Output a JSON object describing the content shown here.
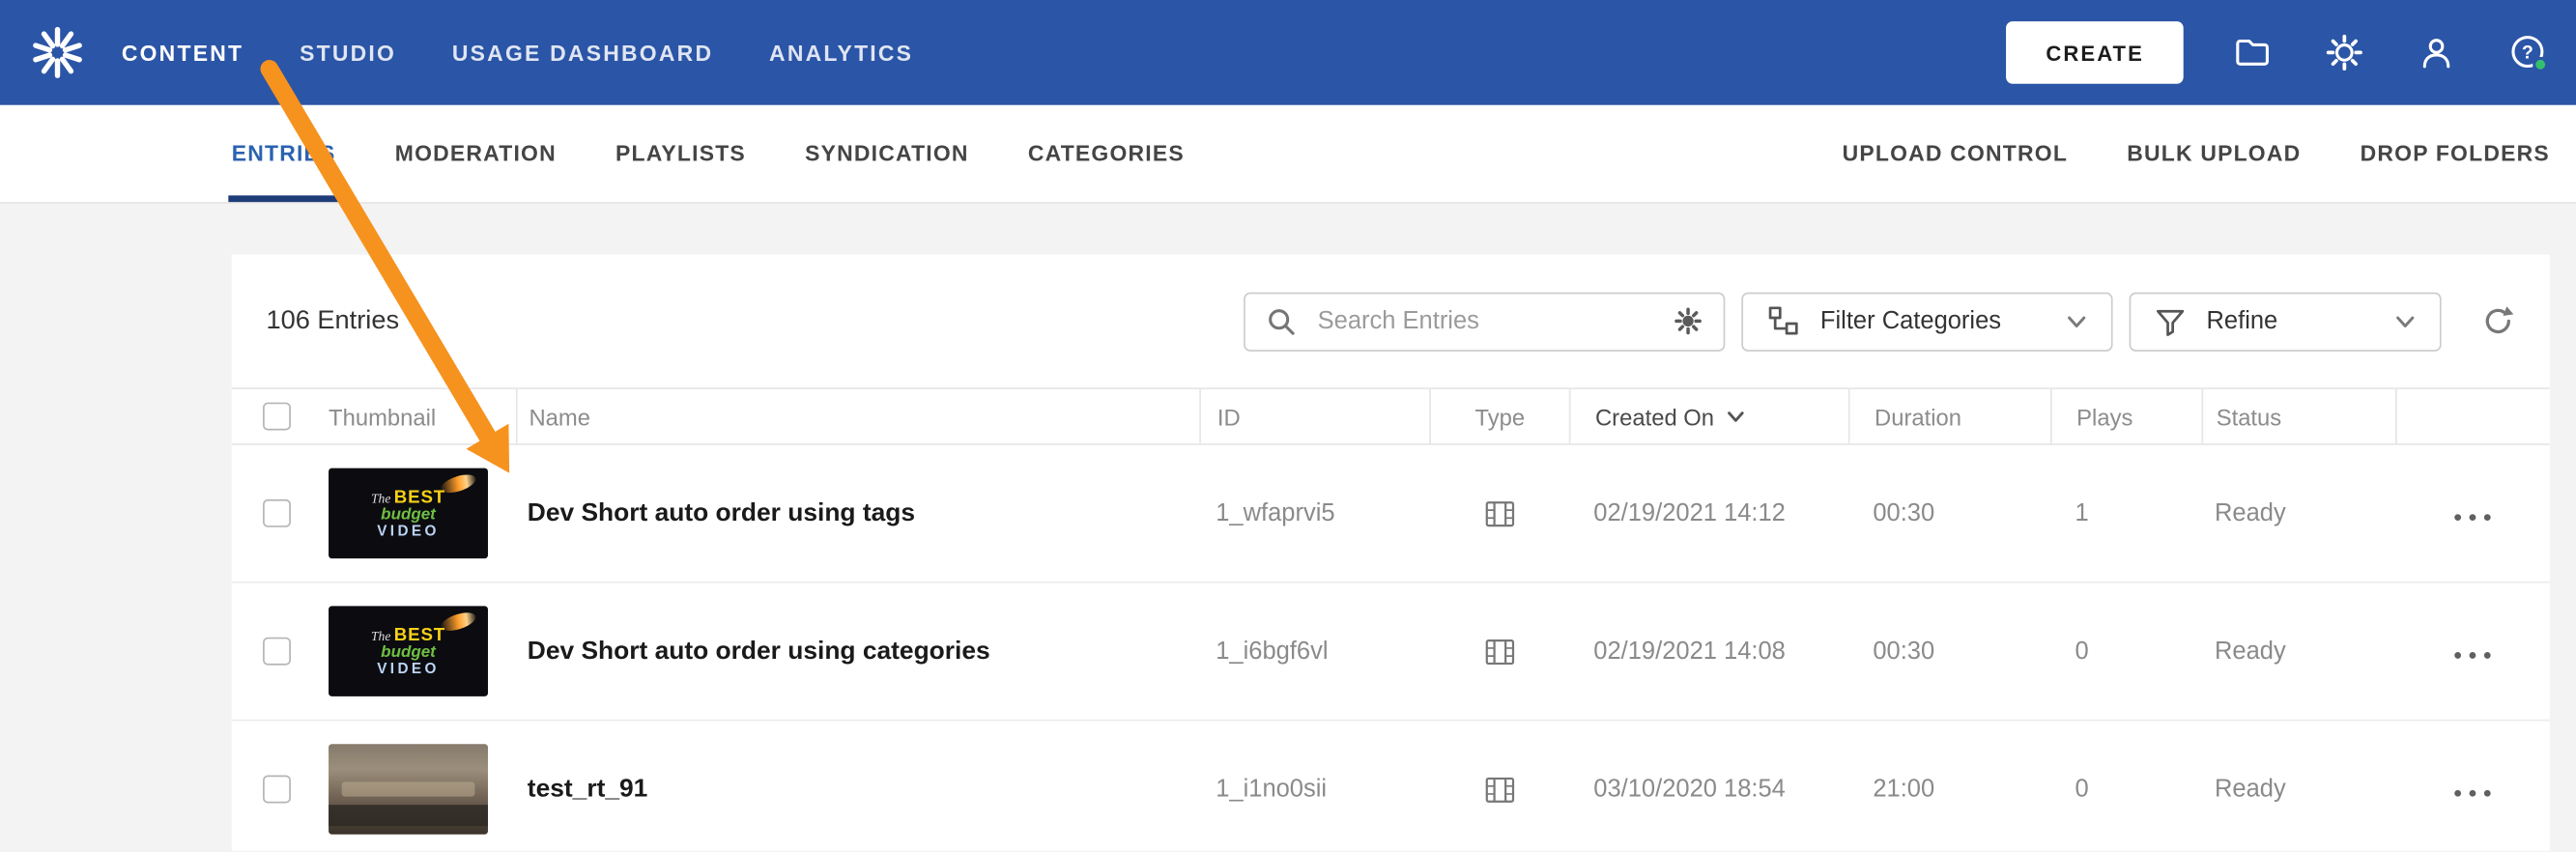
{
  "topbar": {
    "nav_items": [
      {
        "label": "CONTENT",
        "active": true
      },
      {
        "label": "STUDIO",
        "active": false
      },
      {
        "label": "USAGE DASHBOARD",
        "active": false
      },
      {
        "label": "ANALYTICS",
        "active": false
      }
    ],
    "create_label": "CREATE"
  },
  "subnav": {
    "tabs": [
      {
        "label": "ENTRIES",
        "active": true
      },
      {
        "label": "MODERATION",
        "active": false
      },
      {
        "label": "PLAYLISTS",
        "active": false
      },
      {
        "label": "SYNDICATION",
        "active": false
      },
      {
        "label": "CATEGORIES",
        "active": false
      }
    ],
    "links": [
      {
        "label": "UPLOAD CONTROL"
      },
      {
        "label": "BULK UPLOAD"
      },
      {
        "label": "DROP FOLDERS"
      }
    ]
  },
  "toolbar": {
    "entries_count": "106 Entries",
    "search_placeholder": "Search Entries",
    "filter_categories_label": "Filter Categories",
    "refine_label": "Refine"
  },
  "table": {
    "columns": {
      "thumbnail": "Thumbnail",
      "name": "Name",
      "id": "ID",
      "type": "Type",
      "created_on": "Created On",
      "duration": "Duration",
      "plays": "Plays",
      "status": "Status"
    },
    "sort_column": "Created On",
    "sort_direction": "desc",
    "thumb_text": {
      "l1": "The",
      "l2": "BEST",
      "l3": "budget",
      "l4": "VIDEO"
    },
    "rows": [
      {
        "name": "Dev Short auto order using tags",
        "id": "1_wfaprvi5",
        "type": "video",
        "created_on": "02/19/2021 14:12",
        "duration": "00:30",
        "plays": "1",
        "status": "Ready",
        "thumb": "budget-video"
      },
      {
        "name": "Dev Short auto order using categories",
        "id": "1_i6bgf6vl",
        "type": "video",
        "created_on": "02/19/2021 14:08",
        "duration": "00:30",
        "plays": "0",
        "status": "Ready",
        "thumb": "budget-video"
      },
      {
        "name": "test_rt_91",
        "id": "1_i1no0sii",
        "type": "video",
        "created_on": "03/10/2020 18:54",
        "duration": "21:00",
        "plays": "0",
        "status": "Ready",
        "thumb": "courtroom"
      }
    ]
  },
  "annotation": {
    "type": "orange-arrow",
    "color": "#F6921E"
  },
  "colors": {
    "topbar_blue": "#2B55A6",
    "active_tab_blue": "#2B62B0",
    "active_tab_underline": "#1D3C78",
    "arrow_orange": "#F6921E"
  }
}
